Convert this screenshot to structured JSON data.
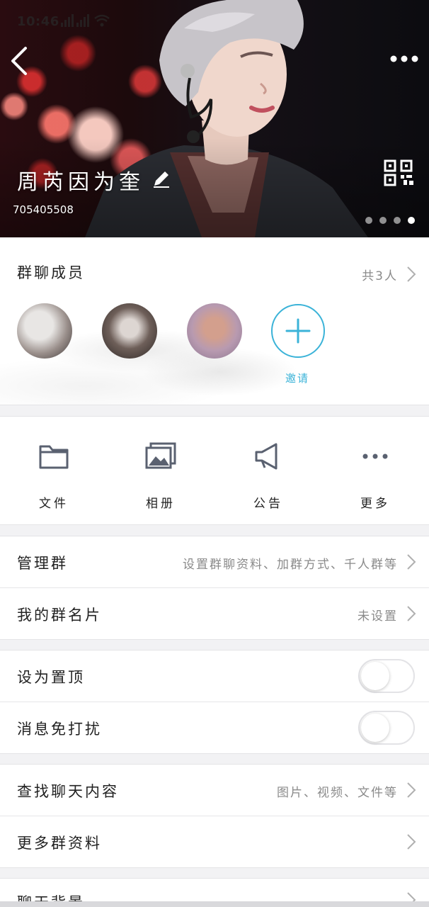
{
  "status_bar": {
    "time": "10:46"
  },
  "header": {
    "group_name": "周芮因为奎",
    "group_id": "705405508",
    "page_count": 4,
    "active_page": 4
  },
  "members": {
    "title": "群聊成员",
    "count_text": "共3人",
    "invite_label": "邀请"
  },
  "actions": [
    {
      "label": "文件",
      "icon": "folder-icon"
    },
    {
      "label": "相册",
      "icon": "album-icon"
    },
    {
      "label": "公告",
      "icon": "megaphone-icon"
    },
    {
      "label": "更多",
      "icon": "more-dots-icon"
    }
  ],
  "manage": {
    "label": "管理群",
    "value": "设置群聊资料、加群方式、千人群等"
  },
  "my_card": {
    "label": "我的群名片",
    "value": "未设置"
  },
  "pin_top": {
    "label": "设为置顶",
    "on": false
  },
  "mute": {
    "label": "消息免打扰",
    "on": false
  },
  "search_history": {
    "label": "查找聊天内容",
    "value": "图片、视频、文件等"
  },
  "more_info": {
    "label": "更多群资料"
  },
  "chat_background": {
    "label": "聊天背景"
  },
  "colors": {
    "accent": "#3bb3d8",
    "icon_gray": "#5a6170"
  }
}
